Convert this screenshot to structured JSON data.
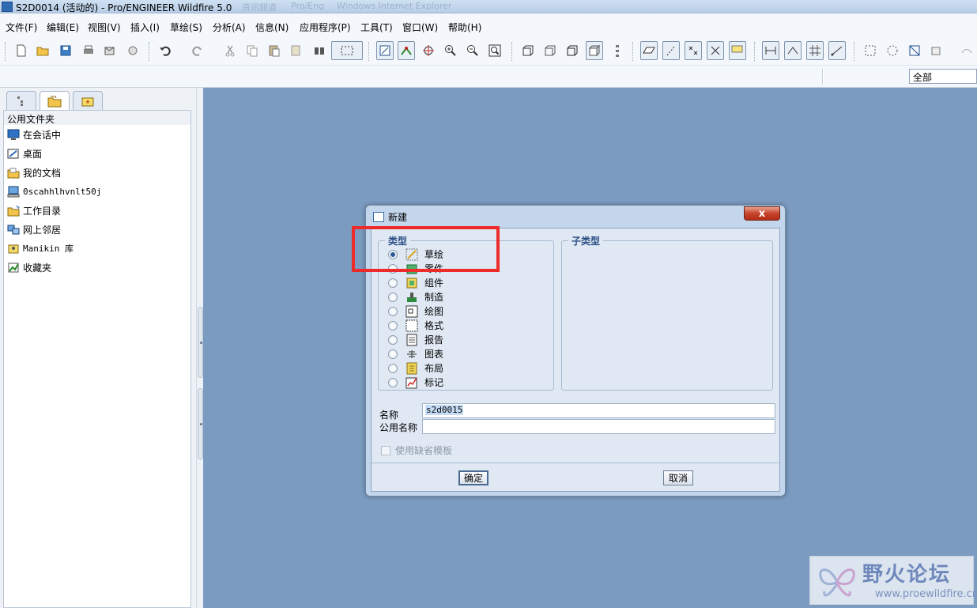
{
  "window": {
    "title": "S2D0014 (活动的) - Pro/ENGINEER Wildfire 5.0",
    "ghost_tabs": [
      "资讯频道",
      "Pro/Eng",
      "Windows Internet Explorer"
    ]
  },
  "menubar": {
    "items": [
      "文件(F)",
      "编辑(E)",
      "视图(V)",
      "插入(I)",
      "草绘(S)",
      "分析(A)",
      "信息(N)",
      "应用程序(P)",
      "工具(T)",
      "窗口(W)",
      "帮助(H)"
    ]
  },
  "toolbar": {
    "filter_value": "全部"
  },
  "navigator": {
    "tabs": [
      "model-tree-tab",
      "folder-browser-tab",
      "favorites-tab"
    ],
    "folder_header": "公用文件夹",
    "folders": [
      {
        "label": "在会话中",
        "icon": "monitor-icon"
      },
      {
        "label": "桌面",
        "icon": "desktop-icon"
      },
      {
        "label": "我的文档",
        "icon": "folder-open-icon"
      },
      {
        "label": "0scahhlhvnlt50j",
        "icon": "computer-icon"
      },
      {
        "label": "工作目录",
        "icon": "working-dir-icon"
      },
      {
        "label": "网上邻居",
        "icon": "network-icon"
      },
      {
        "label": "Manikin 库",
        "icon": "manikin-library-icon"
      },
      {
        "label": "收藏夹",
        "icon": "favorites-icon"
      }
    ]
  },
  "dialog": {
    "title": "新建",
    "close_label": "x",
    "type_group_label": "类型",
    "subtype_group_label": "子类型",
    "types": [
      {
        "label": "草绘",
        "checked": true,
        "icon": "sketch-icon"
      },
      {
        "label": "零件",
        "checked": false,
        "icon": "part-icon"
      },
      {
        "label": "组件",
        "checked": false,
        "icon": "assembly-icon"
      },
      {
        "label": "制造",
        "checked": false,
        "icon": "manufacturing-icon"
      },
      {
        "label": "绘图",
        "checked": false,
        "icon": "drawing-icon"
      },
      {
        "label": "格式",
        "checked": false,
        "icon": "format-icon"
      },
      {
        "label": "报告",
        "checked": false,
        "icon": "report-icon"
      },
      {
        "label": "图表",
        "checked": false,
        "icon": "diagram-icon"
      },
      {
        "label": "布局",
        "checked": false,
        "icon": "layout-icon"
      },
      {
        "label": "标记",
        "checked": false,
        "icon": "markup-icon"
      }
    ],
    "name_label": "名称",
    "name_value": "s2d0015",
    "common_name_label": "公用名称",
    "common_name_value": "",
    "use_default_template_label": "使用缺省模板",
    "ok_label": "确定",
    "cancel_label": "取消"
  },
  "watermark": {
    "cn": "野火论坛",
    "url": "www.proewildfire.cn"
  },
  "colors": {
    "graphics_bg": "#7b9bc1",
    "highlight": "#ee2b2b",
    "accent": "#2b4f86"
  }
}
